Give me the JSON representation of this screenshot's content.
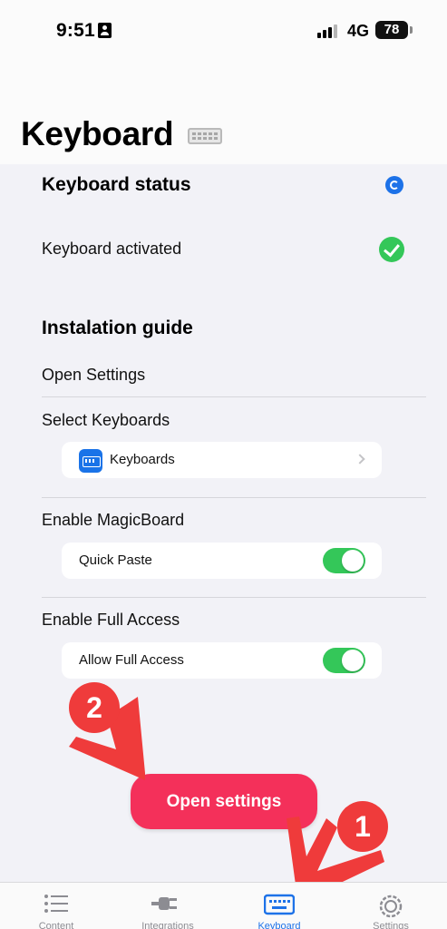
{
  "status_bar": {
    "time": "9:51",
    "network": "4G",
    "battery": "78"
  },
  "header": {
    "title": "Keyboard"
  },
  "keyboard_status": {
    "heading": "Keyboard status",
    "activated_label": "Keyboard activated"
  },
  "guide": {
    "heading": "Instalation guide",
    "open_settings": "Open Settings",
    "select_keyboards": "Select Keyboards",
    "keyboards_card": "Keyboards",
    "enable_magicboard": "Enable MagicBoard",
    "quick_paste": "Quick Paste",
    "enable_full_access": "Enable Full Access",
    "allow_full_access": "Allow Full Access"
  },
  "cta": {
    "label": "Open settings"
  },
  "annotations": {
    "badge_1": "1",
    "badge_2": "2"
  },
  "tabs": [
    {
      "label": "Content",
      "icon": "list-icon",
      "active": false
    },
    {
      "label": "Integrations",
      "icon": "plug-icon",
      "active": false
    },
    {
      "label": "Keyboard",
      "icon": "keyboard-icon",
      "active": true
    },
    {
      "label": "Settings",
      "icon": "gear-icon",
      "active": false
    }
  ],
  "colors": {
    "accent": "#1d72e8",
    "cta": "#f4305a",
    "toggle_on": "#34c759",
    "annotation": "#ef3b3b"
  }
}
